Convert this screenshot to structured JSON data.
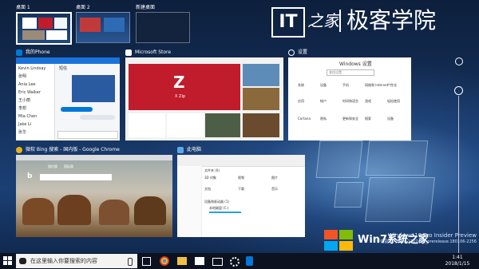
{
  "desktops": [
    {
      "label": "桌面 1",
      "selected": true
    },
    {
      "label": "桌面 2",
      "selected": false
    },
    {
      "label": "新建桌面",
      "selected": false
    }
  ],
  "logo": {
    "it": "IT",
    "mark": "之家",
    "text": "极客学院"
  },
  "windows": {
    "phone": {
      "title": "我的Phone",
      "contacts": [
        "Kevin Lindsay",
        "张明",
        "Ania Lee",
        "Eric Walker",
        "王小丽",
        "李想",
        "Mia Chen",
        "Jake Li",
        "张华"
      ],
      "chat_header": "短信"
    },
    "store": {
      "title": "Microsoft Store",
      "hero_logo": "Z",
      "hero_caption": "X Zip"
    },
    "settings": {
      "title": "设置",
      "heading": "Windows 设置",
      "search_placeholder": "查找设置",
      "items": [
        "系统",
        "设备",
        "手机",
        "网络和 Internet",
        "个性化",
        "应用",
        "帐户",
        "时间和语言",
        "游戏",
        "轻松使用",
        "Cortana",
        "隐私",
        "更新和安全",
        "搜索",
        "设备"
      ]
    },
    "chrome": {
      "title": "微软 Bing 搜索 - 国内版 - Google Chrome",
      "bing_logo": "b",
      "tab_cn": "国内版",
      "tab_intl": "国际版"
    },
    "explorer": {
      "title": "此电脑",
      "section": "文件夹 (6)",
      "folders": [
        "3D 对象",
        "视频",
        "图片",
        "文档",
        "下载",
        "音乐"
      ],
      "drives_label": "设备和驱动器 (1)",
      "drive": "本地磁盘 (C:)"
    }
  },
  "taskbar": {
    "search_placeholder": "在这里输入你要搜索的内容",
    "time": "1:41",
    "date": "2018/1/15"
  },
  "watermark": {
    "line1": "Windows 10 Pro Insider Preview",
    "line2": "评估副本。Build 17074.rs_prerelease.180106-2256",
    "brand": "Win7系统之家"
  },
  "colors": {
    "accent": "#0078d7",
    "taskbar": "#0c1220",
    "store_hero": "#c01c2b"
  }
}
